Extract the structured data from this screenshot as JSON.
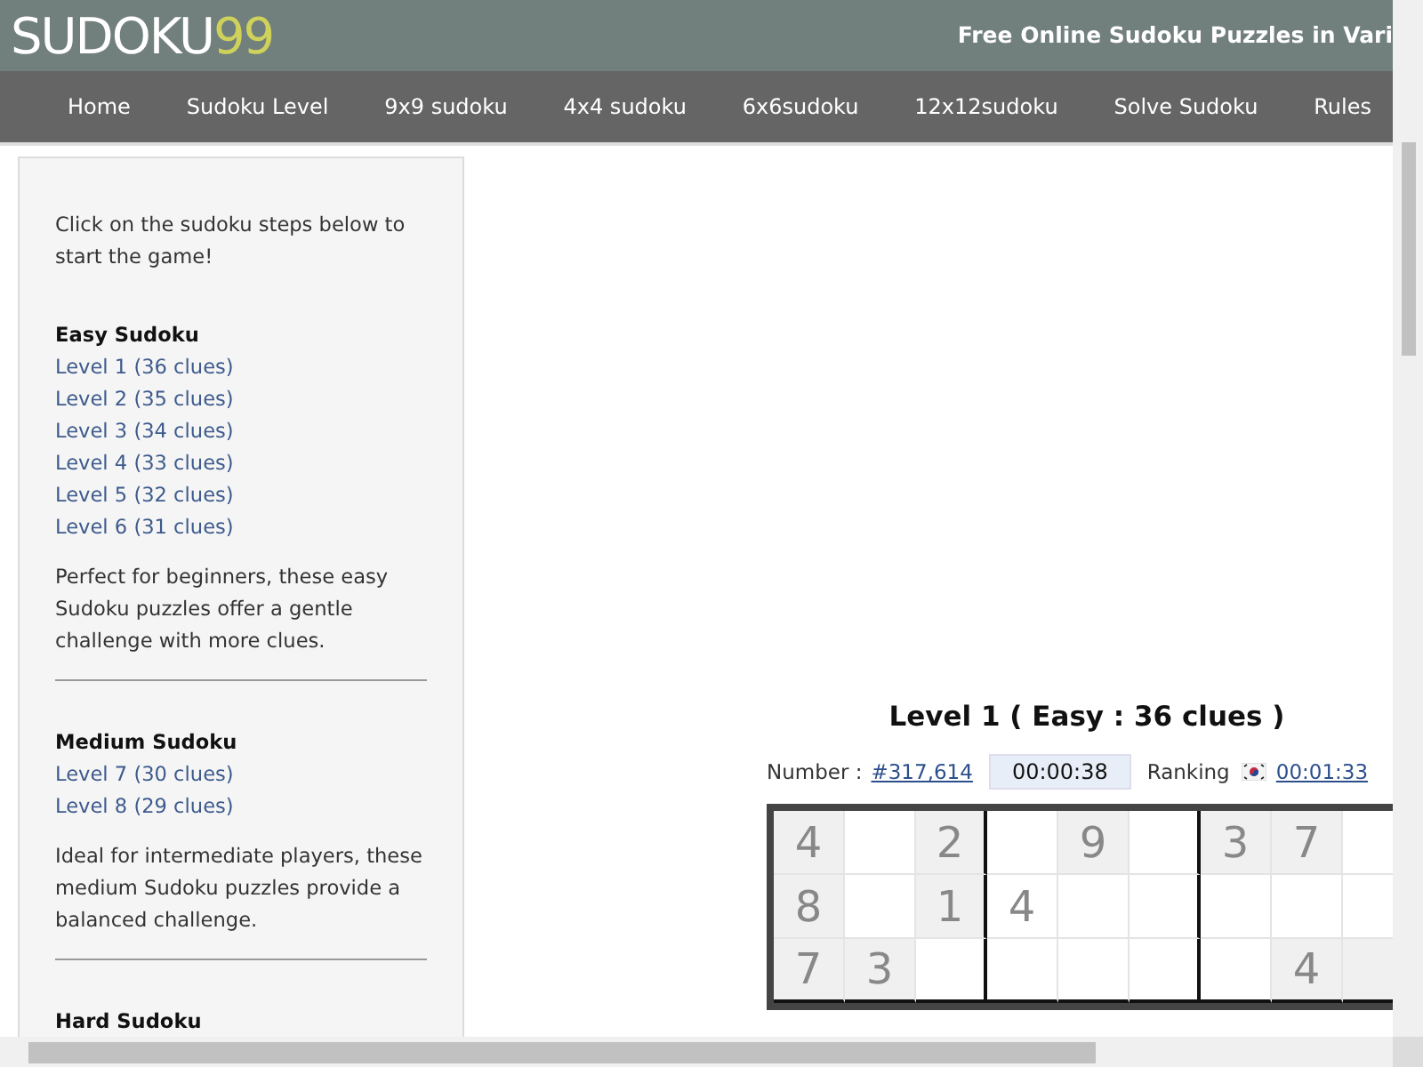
{
  "header": {
    "logo_text": "SUDOKU",
    "logo_number": "99",
    "tagline": "Free Online Sudoku Puzzles in Vari"
  },
  "nav": [
    {
      "label": "Home"
    },
    {
      "label": "Sudoku Level"
    },
    {
      "label": "9x9 sudoku"
    },
    {
      "label": "4x4 sudoku"
    },
    {
      "label": "6x6sudoku"
    },
    {
      "label": "12x12sudoku"
    },
    {
      "label": "Solve Sudoku"
    },
    {
      "label": "Rules"
    }
  ],
  "sidebar": {
    "intro": "Click on the sudoku steps below to start the game!",
    "sections": [
      {
        "heading": "Easy Sudoku",
        "levels": [
          "Level 1 (36 clues)",
          "Level 2 (35 clues)",
          "Level 3 (34 clues)",
          "Level 4 (33 clues)",
          "Level 5 (32 clues)",
          "Level 6 (31 clues)"
        ],
        "description": "Perfect for beginners, these easy Sudoku puzzles offer a gentle challenge with more clues."
      },
      {
        "heading": "Medium Sudoku",
        "levels": [
          "Level 7 (30 clues)",
          "Level 8 (29 clues)"
        ],
        "description": "Ideal for intermediate players, these medium Sudoku puzzles provide a balanced challenge."
      },
      {
        "heading": "Hard Sudoku"
      }
    ]
  },
  "game": {
    "title": "Level 1 ( Easy : 36 clues )",
    "number_label": "Number :",
    "number": "#317,614",
    "timer": "00:00:38",
    "ranking_label": "Ranking",
    "ranking_time": " 00:01:33",
    "rows": [
      [
        {
          "value": "4",
          "given": true
        },
        {
          "given": false
        },
        {
          "value": "2",
          "given": true
        },
        {
          "given": false
        },
        {
          "value": "9",
          "given": true
        },
        {
          "given": false
        },
        {
          "value": "3",
          "given": true
        },
        {
          "value": "7",
          "given": true
        },
        {
          "given": false
        }
      ],
      [
        {
          "value": "8",
          "given": true
        },
        {
          "given": false
        },
        {
          "value": "1",
          "given": true
        },
        {
          "value": "4",
          "given": false
        },
        {
          "given": false
        },
        {
          "given": false
        },
        {
          "given": false
        },
        {
          "given": false
        },
        {
          "given": false
        }
      ],
      [
        {
          "value": "7",
          "given": true
        },
        {
          "value": "3",
          "given": true
        },
        {
          "given": false
        },
        {
          "given": false
        },
        {
          "given": false
        },
        {
          "given": false
        },
        {
          "given": false
        },
        {
          "value": "4",
          "given": true
        },
        {
          "given": true
        }
      ]
    ]
  }
}
